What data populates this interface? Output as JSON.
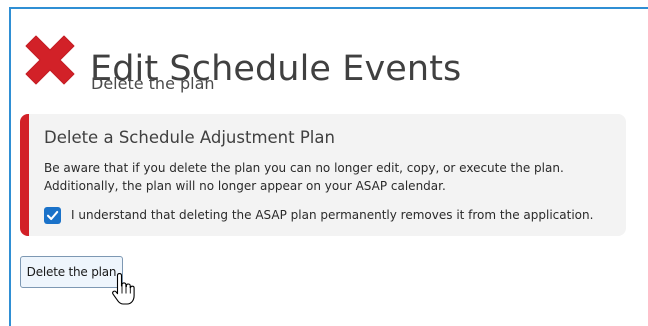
{
  "header": {
    "title": "Edit Schedule Events",
    "subtitle": "Delete the plan",
    "icon": "close-x-icon",
    "icon_color": "#d22128"
  },
  "warning": {
    "title": "Delete a Schedule Adjustment Plan",
    "message_line_1": "Be aware that if you delete the plan you can no longer edit, copy, or execute the plan.",
    "message_line_2": "Additionally, the plan will no longer appear on your ASAP calendar.",
    "accent_color": "#d22128"
  },
  "confirm": {
    "checked": true,
    "label": "I understand that deleting the ASAP plan permanently removes it from the application."
  },
  "actions": {
    "delete_label": "Delete the plan"
  },
  "cursor": {
    "type": "hand-pointer-cursor"
  }
}
